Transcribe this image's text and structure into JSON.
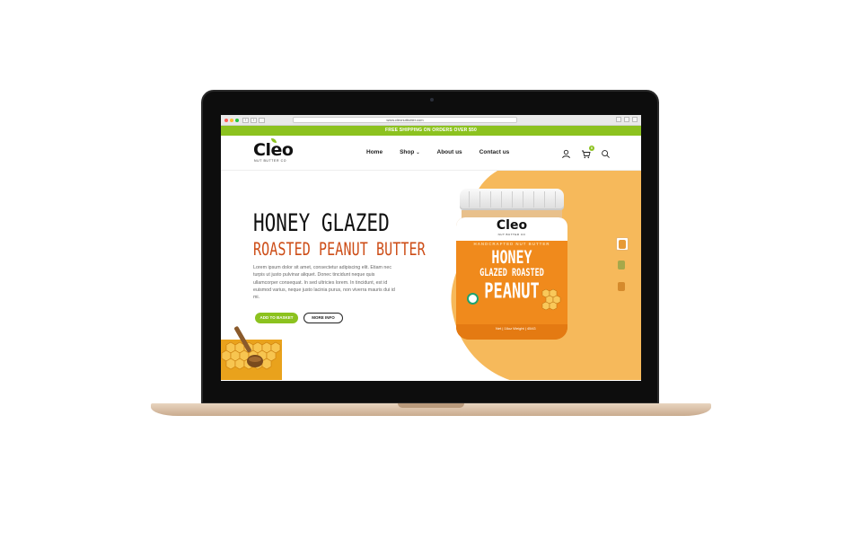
{
  "browser": {
    "url": "www.cleonutbutter.com"
  },
  "banner": {
    "text": "FREE SHIPPING ON ORDERS OVER $50"
  },
  "header": {
    "logo": "Cleo",
    "logo_sub": "NUT BUTTER CO",
    "nav": [
      {
        "label": "Home"
      },
      {
        "label": "Shop"
      },
      {
        "label": "About us"
      },
      {
        "label": "Contact us"
      }
    ],
    "cart_count": "0"
  },
  "hero": {
    "title_line1": "HONEY GLAZED",
    "title_line2": "ROASTED PEANUT BUTTER",
    "description": "Lorem ipsum dolor sit amet, consectetur adipiscing elit. Etiam nec turpis ut justo pulvinar aliquet. Donec tincidunt neque quis ullamcorper consequat. In sed ultricies lorem. In tincidunt, est id euismod varius, neque justo lacinia purus, non viverra mauris dui id mi.",
    "add_to_cart": "ADD TO BASKET",
    "more_info": "MORE INFO"
  },
  "jar": {
    "logo": "Cleo",
    "logo_sub": "NUT BUTTER CO",
    "tagline": "HANDCRAFTED NUT BUTTER",
    "name_line1": "HONEY",
    "name_line2": "GLAZED ROASTED",
    "name_line3": "PEANUT",
    "net_weight": "Net | 16oz Weight | 454G"
  },
  "colors": {
    "accent_green": "#8cc21f",
    "hero_orange": "#f6b95b",
    "title_orange": "#cd4d17"
  }
}
